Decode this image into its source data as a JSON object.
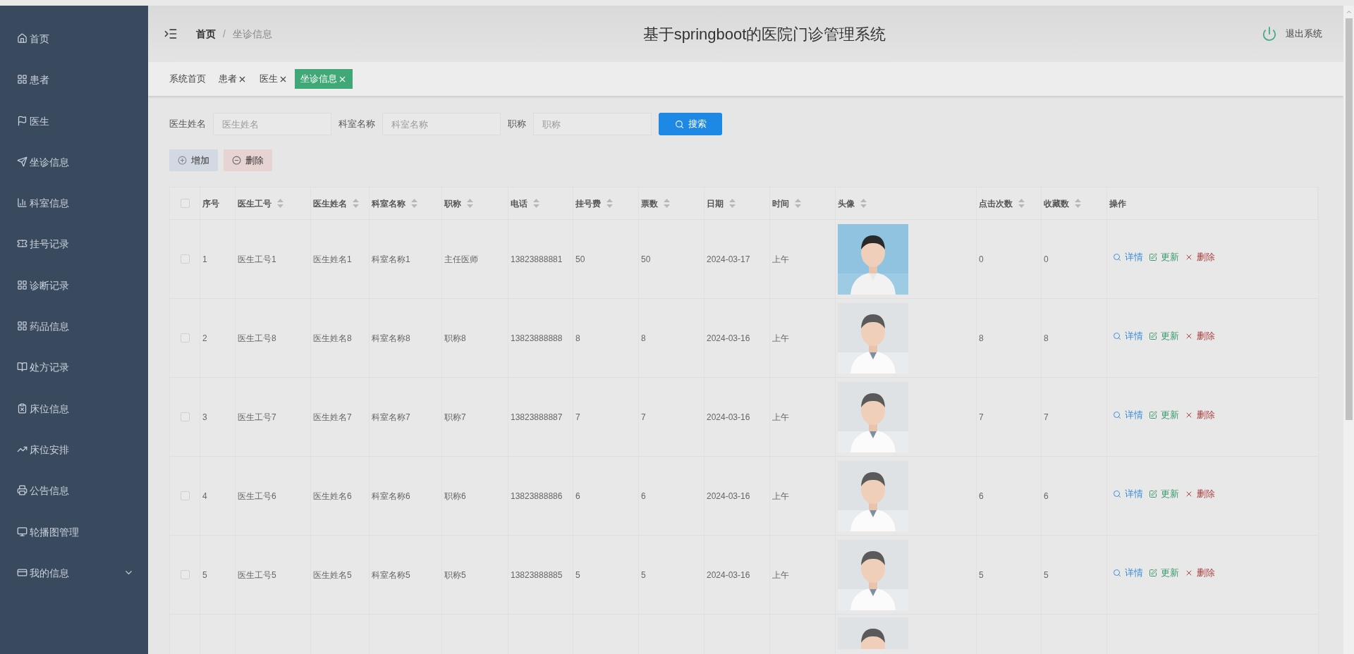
{
  "sidebar": {
    "items": [
      {
        "label": "首页"
      },
      {
        "label": "患者"
      },
      {
        "label": "医生"
      },
      {
        "label": "坐诊信息"
      },
      {
        "label": "科室信息"
      },
      {
        "label": "挂号记录"
      },
      {
        "label": "诊断记录"
      },
      {
        "label": "药品信息"
      },
      {
        "label": "处方记录"
      },
      {
        "label": "床位信息"
      },
      {
        "label": "床位安排"
      },
      {
        "label": "公告信息"
      },
      {
        "label": "轮播图管理"
      },
      {
        "label": "我的信息",
        "expanded": false
      }
    ]
  },
  "header": {
    "breadcrumb": [
      "首页",
      "坐诊信息"
    ],
    "separator": "/",
    "title": "基于springboot的医院门诊管理系统",
    "logout": "退出系统"
  },
  "tabs": [
    {
      "label": "系统首页",
      "closable": false,
      "selected": false
    },
    {
      "label": "患者",
      "closable": true,
      "selected": false
    },
    {
      "label": "医生",
      "closable": true,
      "selected": false
    },
    {
      "label": "坐诊信息",
      "closable": true,
      "selected": true
    }
  ],
  "search": {
    "fields": [
      {
        "label": "医生姓名",
        "placeholder": "医生姓名"
      },
      {
        "label": "科室名称",
        "placeholder": "科室名称"
      },
      {
        "label": "职称",
        "placeholder": "职称"
      }
    ],
    "button": "搜索"
  },
  "actions": [
    {
      "kind": "add",
      "label": "增加"
    },
    {
      "kind": "delete",
      "label": "删除"
    }
  ],
  "table": {
    "all_checked": false,
    "columns": [
      {
        "label": "序号",
        "sortable": false
      },
      {
        "label": "医生工号",
        "sortable": true
      },
      {
        "label": "医生姓名",
        "sortable": true
      },
      {
        "label": "科室名称",
        "sortable": true
      },
      {
        "label": "职称",
        "sortable": true
      },
      {
        "label": "电话",
        "sortable": true
      },
      {
        "label": "挂号费",
        "sortable": true
      },
      {
        "label": "票数",
        "sortable": true
      },
      {
        "label": "日期",
        "sortable": true
      },
      {
        "label": "时间",
        "sortable": true
      },
      {
        "label": "头像",
        "sortable": true
      },
      {
        "label": "点击次数",
        "sortable": true
      },
      {
        "label": "收藏数",
        "sortable": true
      },
      {
        "label": "操作",
        "sortable": false
      }
    ],
    "rows": [
      {
        "checked": false,
        "cells": [
          "1",
          "医生工号1",
          "医生姓名1",
          "科室名称1",
          "主任医师",
          "13823888881",
          "50",
          "50",
          "2024-03-17",
          "上午"
        ],
        "avatar": {
          "kind": "picture"
        },
        "clicks": "0",
        "favorites": "0",
        "actions": [
          {
            "kind": "detail",
            "label": "详情"
          },
          {
            "kind": "update",
            "label": "更新"
          },
          {
            "kind": "delete",
            "label": "删除"
          }
        ]
      },
      {
        "checked": false,
        "cells": [
          "2",
          "医生工号8",
          "医生姓名8",
          "科室名称8",
          "职称8",
          "13823888888",
          "8",
          "8",
          "2024-03-16",
          "上午"
        ],
        "avatar": {
          "kind": "picture"
        },
        "clicks": "8",
        "favorites": "8",
        "actions": [
          {
            "kind": "detail",
            "label": "详情"
          },
          {
            "kind": "update",
            "label": "更新"
          },
          {
            "kind": "delete",
            "label": "删除"
          }
        ]
      },
      {
        "checked": false,
        "cells": [
          "3",
          "医生工号7",
          "医生姓名7",
          "科室名称7",
          "职称7",
          "13823888887",
          "7",
          "7",
          "2024-03-16",
          "上午"
        ],
        "avatar": {
          "kind": "picture"
        },
        "clicks": "7",
        "favorites": "7",
        "actions": [
          {
            "kind": "detail",
            "label": "详情"
          },
          {
            "kind": "update",
            "label": "更新"
          },
          {
            "kind": "delete",
            "label": "删除"
          }
        ]
      },
      {
        "checked": false,
        "cells": [
          "4",
          "医生工号6",
          "医生姓名6",
          "科室名称6",
          "职称6",
          "13823888886",
          "6",
          "6",
          "2024-03-16",
          "上午"
        ],
        "avatar": {
          "kind": "picture"
        },
        "clicks": "6",
        "favorites": "6",
        "actions": [
          {
            "kind": "detail",
            "label": "详情"
          },
          {
            "kind": "update",
            "label": "更新"
          },
          {
            "kind": "delete",
            "label": "删除"
          }
        ]
      },
      {
        "checked": false,
        "cells": [
          "5",
          "医生工号5",
          "医生姓名5",
          "科室名称5",
          "职称5",
          "13823888885",
          "5",
          "5",
          "2024-03-16",
          "上午"
        ],
        "avatar": {
          "kind": "picture"
        },
        "clicks": "5",
        "favorites": "5",
        "actions": [
          {
            "kind": "detail",
            "label": "详情"
          },
          {
            "kind": "update",
            "label": "更新"
          },
          {
            "kind": "delete",
            "label": "删除"
          }
        ]
      }
    ],
    "partial_row": {
      "avatar": {
        "kind": "picture"
      }
    }
  }
}
